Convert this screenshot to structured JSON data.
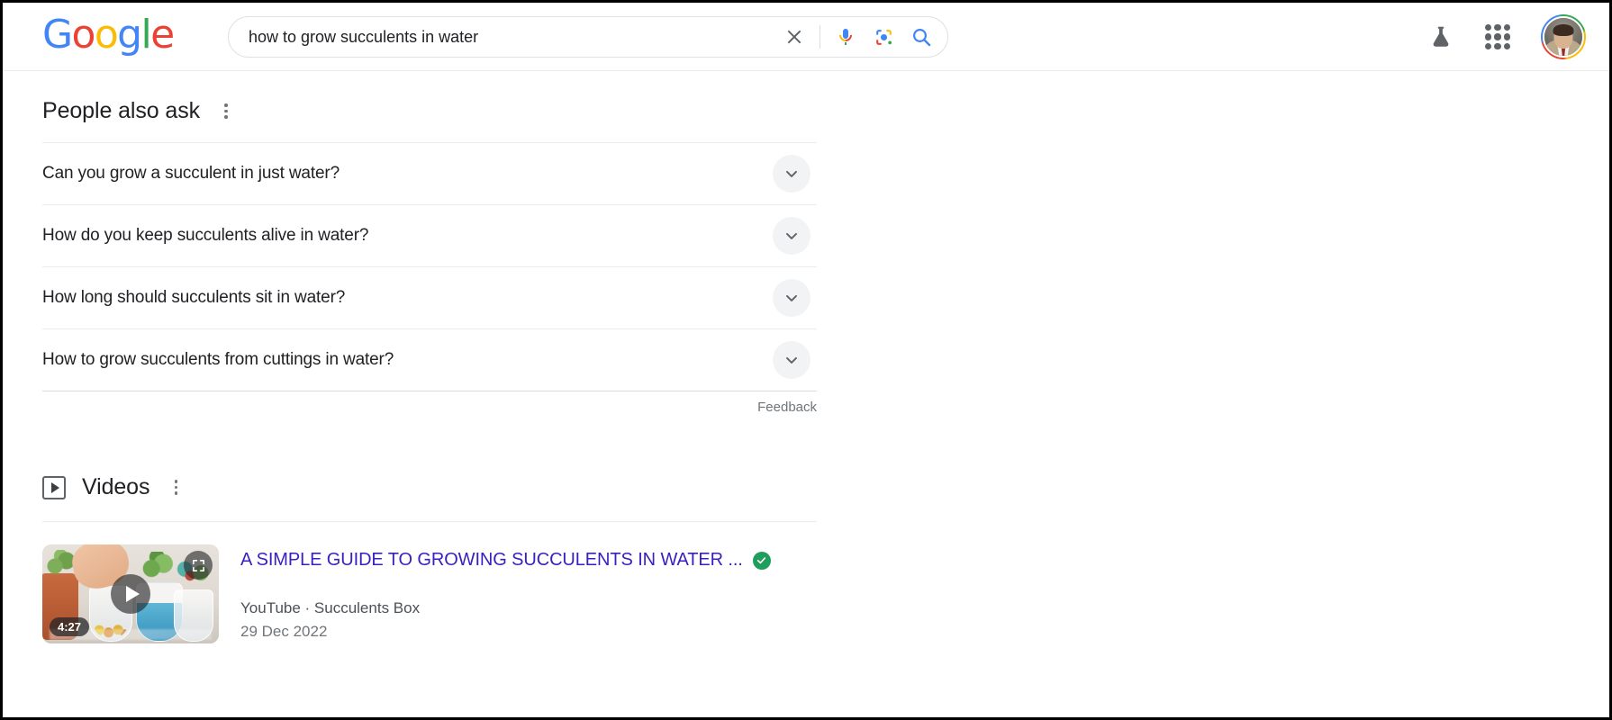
{
  "header": {
    "logo_letters": [
      "G",
      "o",
      "o",
      "g",
      "l",
      "e"
    ],
    "search": {
      "query": "how to grow succulents in water",
      "placeholder": "Search",
      "clear_icon": "close-icon",
      "voice_icon": "microphone-icon",
      "lens_icon": "google-lens-icon",
      "submit_icon": "search-icon"
    },
    "right_icons": {
      "labs": "lab-flask-icon",
      "apps": "apps-grid-icon",
      "account": "avatar-icon"
    }
  },
  "people_also_ask": {
    "title": "People also ask",
    "menu_icon": "kebab-menu-icon",
    "questions": [
      {
        "text": "Can you grow a succulent in just water?",
        "expand_icon": "chevron-down-icon"
      },
      {
        "text": "How do you keep succulents alive in water?",
        "expand_icon": "chevron-down-icon"
      },
      {
        "text": "How long should succulents sit in water?",
        "expand_icon": "chevron-down-icon"
      },
      {
        "text": "How to grow succulents from cuttings in water?",
        "expand_icon": "chevron-down-icon"
      }
    ],
    "feedback_label": "Feedback"
  },
  "videos": {
    "title": "Videos",
    "section_icon": "video-play-badge-icon",
    "menu_icon": "kebab-menu-icon",
    "results": [
      {
        "title": "A SIMPLE GUIDE TO GROWING SUCCULENTS IN WATER ...",
        "verified_icon": "verified-check-icon",
        "source": "YouTube · Succulents Box",
        "date": "29 Dec 2022",
        "duration": "4:27",
        "play_icon": "play-icon",
        "expand_icon": "expand-icon",
        "thumbnail_alt": "Hands placing succulent cuttings into glass jars filled with water and coloured beads"
      }
    ]
  },
  "colors": {
    "google_blue": "#4285F4",
    "google_red": "#EA4335",
    "google_yellow": "#FBBC05",
    "google_green": "#34A853",
    "link_visited": "#3a1fbf",
    "text_primary": "#202124",
    "text_secondary": "#70757a",
    "verified_green": "#1e9e5a"
  }
}
